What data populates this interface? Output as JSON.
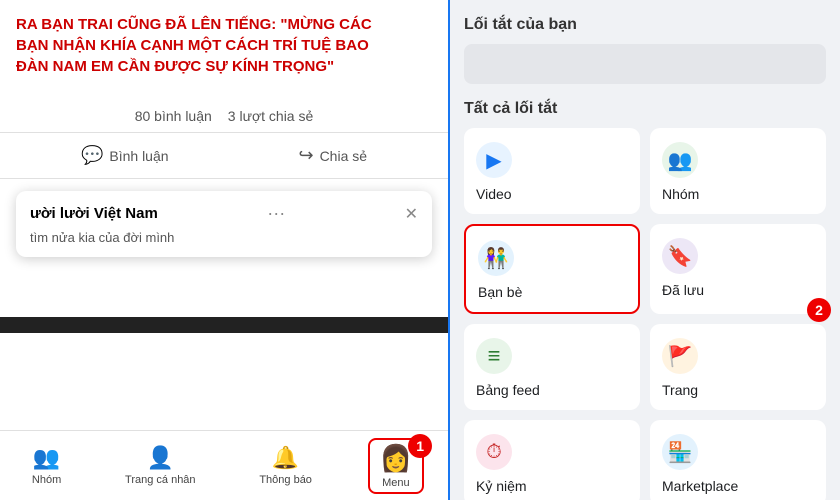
{
  "left": {
    "headline_line1": "RA BẠN TRAI CŨNG ĐÃ LÊN TIẾNG: \"MỪNG CÁC",
    "headline_line2": "BẠN NHẬN KHÍA CẠNH MỘT CÁCH TRÍ TUỆ BAO",
    "headline_line3": "ĐÀN NAM EM CẦN ĐƯỢC SỰ KÍNH TRỌNG\"",
    "comments_label": "80 bình luận",
    "shares_label": "3 lượt chia sẻ",
    "comment_btn": "Bình luận",
    "share_btn": "Chia sẻ",
    "chat_title": "ười lười Việt Nam",
    "chat_subtitle": "tìm nửa kia của đời mình",
    "nav_groups": "Nhóm",
    "nav_profile": "Trang cá nhân",
    "nav_notifications": "Thông báo",
    "nav_menu": "Menu",
    "step1": "1"
  },
  "right": {
    "shortcuts_title": "Lối tắt của bạn",
    "all_shortcuts_title": "Tất cả lối tắt",
    "items": [
      {
        "id": "video",
        "label": "Video",
        "icon": "▶",
        "icon_class": "icon-video",
        "highlighted": false
      },
      {
        "id": "groups",
        "label": "Nhóm",
        "icon": "👥",
        "icon_class": "icon-group",
        "highlighted": false
      },
      {
        "id": "friends",
        "label": "Bạn bè",
        "icon": "👫",
        "icon_class": "icon-friends",
        "highlighted": true,
        "step": ""
      },
      {
        "id": "saved",
        "label": "Đã lưu",
        "icon": "🔖",
        "icon_class": "icon-saved",
        "highlighted": false
      },
      {
        "id": "feed",
        "label": "Bảng feed",
        "icon": "≡",
        "icon_class": "icon-feed",
        "highlighted": false
      },
      {
        "id": "pages",
        "label": "Trang",
        "icon": "🚩",
        "icon_class": "icon-pages",
        "highlighted": false,
        "step2": "2"
      },
      {
        "id": "memories",
        "label": "Kỷ niệm",
        "icon": "⏱",
        "icon_class": "icon-memories",
        "highlighted": false
      },
      {
        "id": "marketplace",
        "label": "Marketplace",
        "icon": "🏪",
        "icon_class": "icon-marketplace",
        "highlighted": false
      }
    ]
  }
}
